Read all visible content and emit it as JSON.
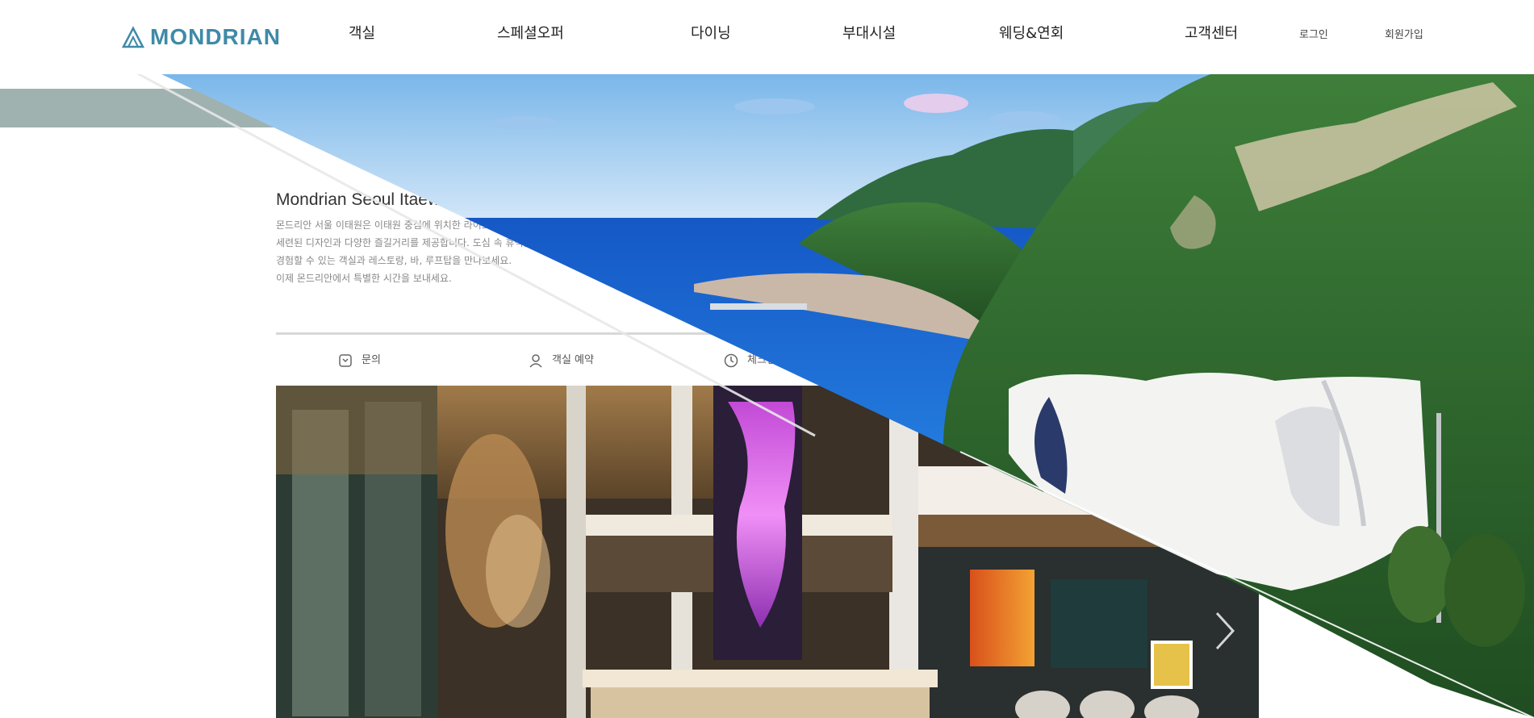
{
  "header": {
    "logo_text": "MONDRIAN",
    "nav": [
      {
        "label": "객실"
      },
      {
        "label": "스페셜오퍼"
      },
      {
        "label": "다이닝"
      },
      {
        "label": "부대시설"
      },
      {
        "label": "웨딩&연회"
      },
      {
        "label": "고객센터"
      }
    ],
    "utility": [
      {
        "label": "로그인"
      },
      {
        "label": "회원가입"
      }
    ]
  },
  "content": {
    "hotel_title": "Mondrian Seoul Itaewon",
    "description": [
      "몬드리안 서울 이태원은 이태원 중심에 위치한 라이프스타일 호텔로",
      "세련된 디자인과 다양한 즐길거리를 제공합니다. 도심 속 휴식을",
      "경험할 수 있는 객실과 레스토랑, 바, 루프탑을 만나보세요.",
      "이제 몬드리안에서 특별한 시간을 보내세요."
    ],
    "info": [
      {
        "icon": "phone-icon",
        "label": "문의"
      },
      {
        "icon": "user-icon",
        "label": "객실 예약"
      },
      {
        "icon": "clock-icon",
        "label": "체크인"
      }
    ]
  },
  "colors": {
    "brand": "#3f8aa8",
    "band": "#9fb2b0",
    "sea": "#1f6fd1",
    "sky": "#8ec4ef",
    "forest": "#2f6b2a"
  }
}
